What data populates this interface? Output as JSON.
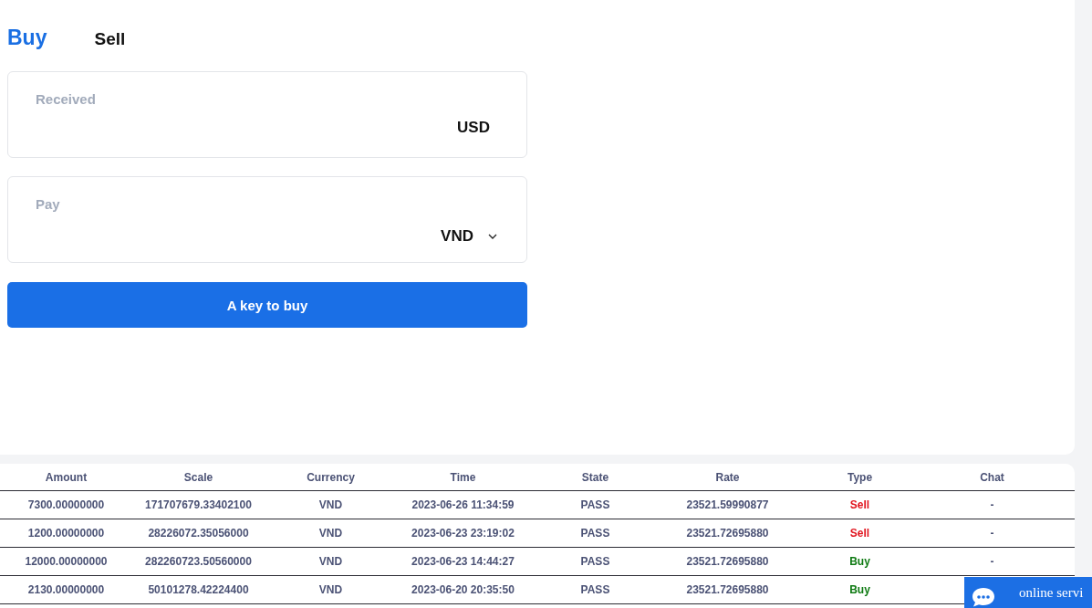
{
  "trade_form": {
    "tabs": [
      {
        "label": "Buy",
        "selected": true
      },
      {
        "label": "Sell",
        "selected": false
      }
    ],
    "fields": [
      {
        "kind": "fixed",
        "label": "Received",
        "currency": "USD"
      },
      {
        "kind": "dropdown",
        "label": "Pay",
        "currency": "VND"
      }
    ],
    "submit_button": "A key to buy"
  },
  "orders_table": {
    "columns": [
      "Amount",
      "Scale",
      "Currency",
      "Time",
      "State",
      "Rate",
      "Type",
      "Chat"
    ],
    "rows": [
      {
        "amount": "7300.00000000",
        "scale": "171707679.33402100",
        "currency": "VND",
        "time": "2023-06-26 11:34:59",
        "state": "PASS",
        "rate": "23521.59990877",
        "type": {
          "label": "Sell",
          "color": "#e1141e"
        },
        "chat": "-"
      },
      {
        "amount": "1200.00000000",
        "scale": "28226072.35056000",
        "currency": "VND",
        "time": "2023-06-23 23:19:02",
        "state": "PASS",
        "rate": "23521.72695880",
        "type": {
          "label": "Sell",
          "color": "#e1141e"
        },
        "chat": "-"
      },
      {
        "amount": "12000.00000000",
        "scale": "282260723.50560000",
        "currency": "VND",
        "time": "2023-06-23 14:44:27",
        "state": "PASS",
        "rate": "23521.72695880",
        "type": {
          "label": "Buy",
          "color": "#0e7a12"
        },
        "chat": "-"
      },
      {
        "amount": "2130.00000000",
        "scale": "50101278.42224400",
        "currency": "VND",
        "time": "2023-06-20 20:35:50",
        "state": "PASS",
        "rate": "23521.72695880",
        "type": {
          "label": "Buy",
          "color": "#0e7a12"
        }
      }
    ]
  },
  "chat_widget": {
    "label": "online servi"
  }
}
